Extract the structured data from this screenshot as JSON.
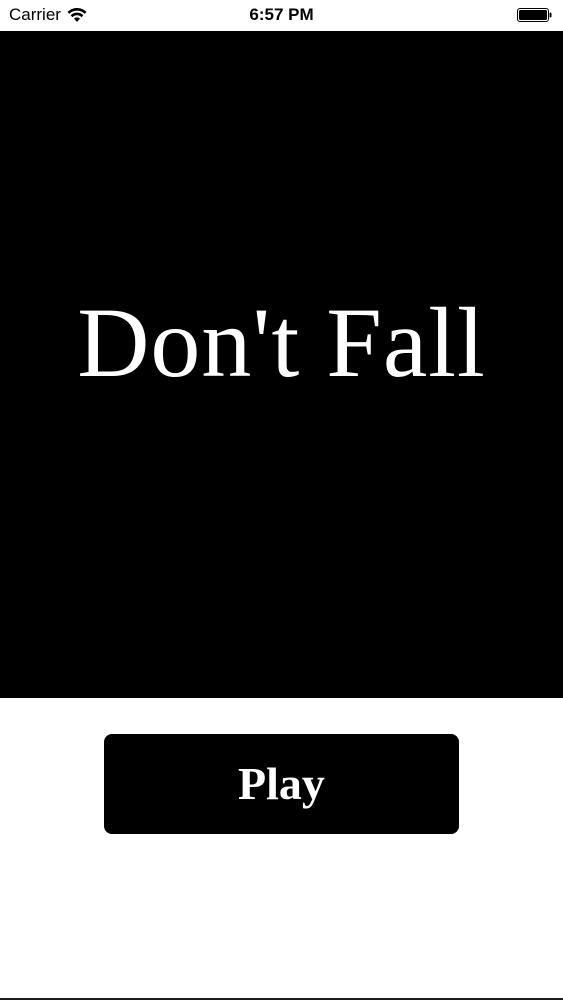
{
  "status_bar": {
    "carrier": "Carrier",
    "time": "6:57 PM",
    "wifi_icon": "wifi-icon",
    "battery_icon": "battery-full-icon"
  },
  "game": {
    "title": "Don't Fall",
    "play_label": "Play"
  },
  "colors": {
    "panel": "#000000",
    "text": "#ffffff",
    "background": "#ffffff"
  }
}
